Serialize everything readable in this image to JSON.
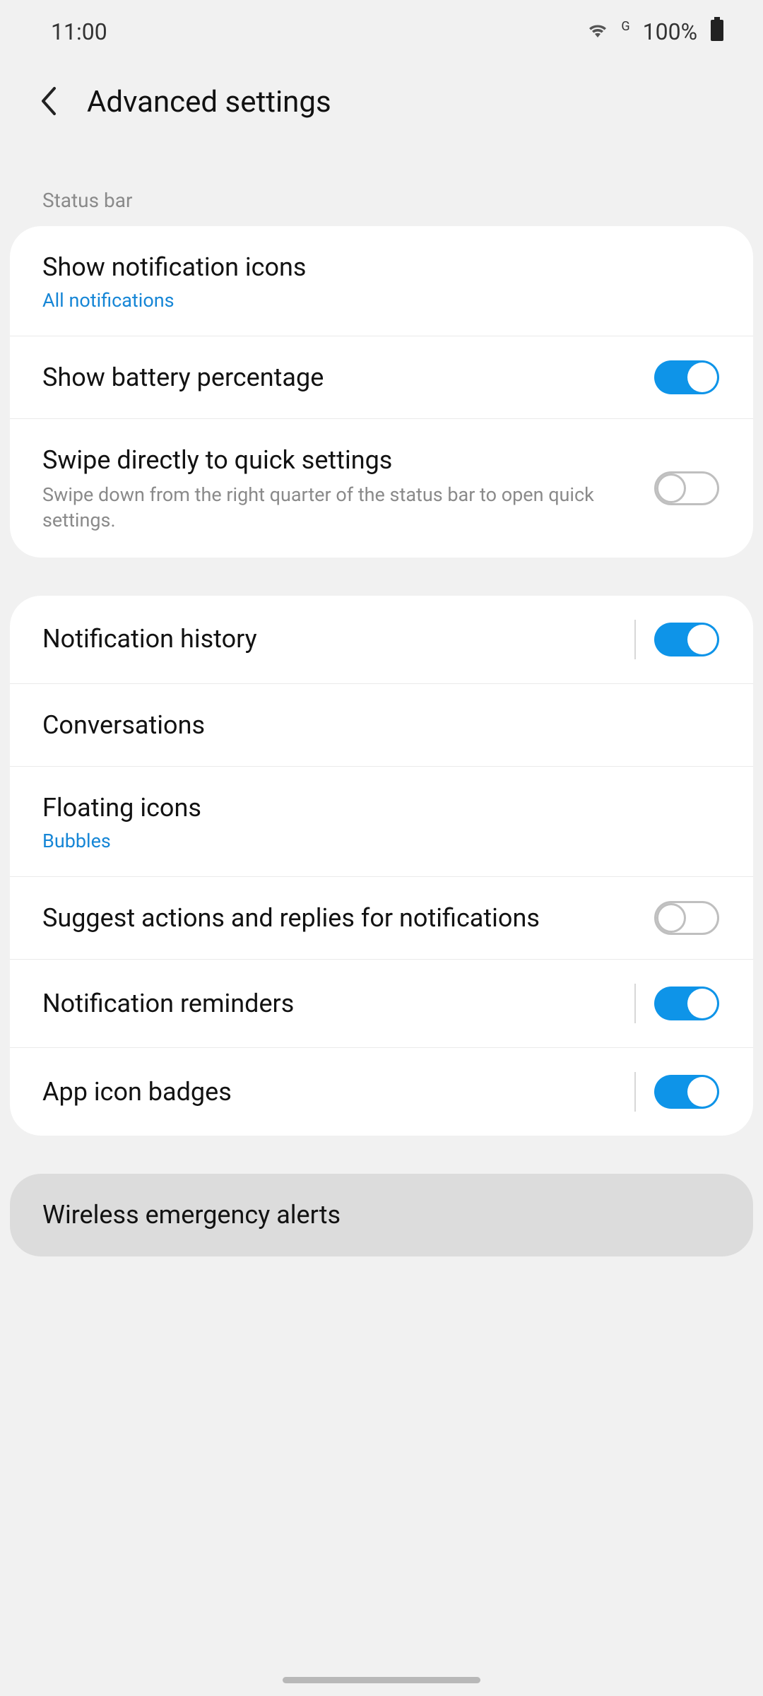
{
  "status": {
    "time": "11:00",
    "network_indicator": "G",
    "battery_percent": "100%"
  },
  "header": {
    "title": "Advanced settings"
  },
  "section_labels": {
    "status_bar": "Status bar"
  },
  "rows": {
    "show_notification_icons": {
      "title": "Show notification icons",
      "sub": "All notifications"
    },
    "show_battery_percentage": {
      "title": "Show battery percentage",
      "on": true
    },
    "swipe_quick_settings": {
      "title": "Swipe directly to quick settings",
      "sub": "Swipe down from the right quarter of the status bar to open quick settings.",
      "on": false
    },
    "notification_history": {
      "title": "Notification history",
      "on": true
    },
    "conversations": {
      "title": "Conversations"
    },
    "floating_icons": {
      "title": "Floating icons",
      "sub": "Bubbles"
    },
    "suggest_actions": {
      "title": "Suggest actions and replies for notifications",
      "on": false
    },
    "notification_reminders": {
      "title": "Notification reminders",
      "on": true
    },
    "app_icon_badges": {
      "title": "App icon badges",
      "on": true
    },
    "wireless_emergency_alerts": {
      "title": "Wireless emergency alerts"
    }
  }
}
